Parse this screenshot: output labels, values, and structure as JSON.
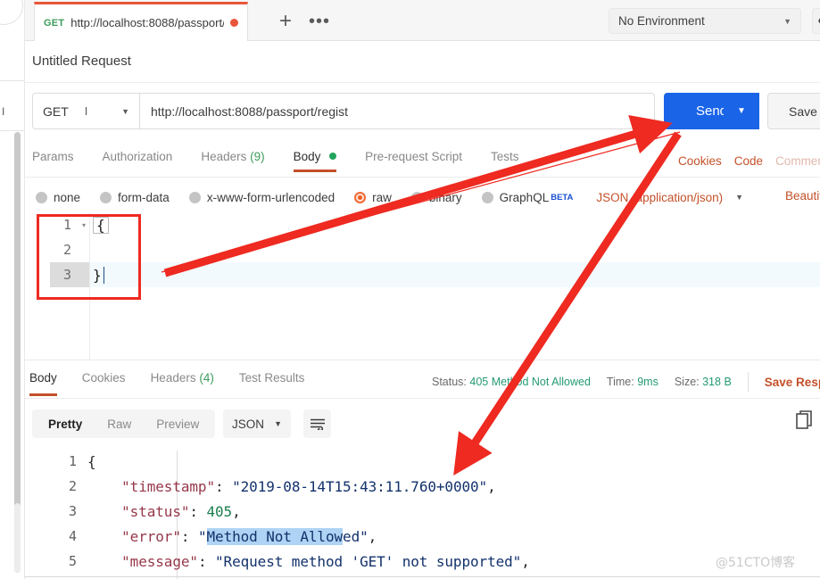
{
  "window": {
    "app": "Postman"
  },
  "tabbar": {
    "request_tab": {
      "method": "GET",
      "url": "http://localhost:8088/passport/...",
      "unsaved_dot": "unsaved-indicator"
    },
    "new_tab_label": "+",
    "more_label": "•••",
    "environment": {
      "selected": "No Environment",
      "caret": "▼"
    },
    "eye_icon": "eye-icon"
  },
  "request": {
    "title": "Untitled Request",
    "method": "GET",
    "method_caret": "▼",
    "url": "http://localhost:8088/passport/regist",
    "send_label": "Send",
    "send_caret": "▼",
    "save_label": "Save",
    "tabs": [
      {
        "label": "Params",
        "active": false
      },
      {
        "label": "Authorization",
        "active": false
      },
      {
        "label": "Headers",
        "count": "(9)",
        "active": false
      },
      {
        "label": "Body",
        "active": true,
        "dot": true
      },
      {
        "label": "Pre-request Script",
        "active": false
      },
      {
        "label": "Tests",
        "active": false
      }
    ],
    "actions": [
      {
        "label": "Cookies",
        "muted": false
      },
      {
        "label": "Code",
        "muted": false
      },
      {
        "label": "Comments",
        "muted": true
      }
    ],
    "body_types": [
      {
        "label": "none",
        "selected": false
      },
      {
        "label": "form-data",
        "selected": false
      },
      {
        "label": "x-www-form-urlencoded",
        "selected": false
      },
      {
        "label": "raw",
        "selected": true
      },
      {
        "label": "binary",
        "selected": false
      },
      {
        "label": "GraphQL",
        "selected": false,
        "badge": "BETA"
      }
    ],
    "content_type": "JSON (application/json)",
    "content_type_caret": "▼",
    "beautify_label": "Beautify",
    "body_editor": {
      "lines": [
        {
          "num": "1",
          "text": "{",
          "fold": "▾",
          "active": false
        },
        {
          "num": "2",
          "text": "",
          "fold": "",
          "active": false
        },
        {
          "num": "3",
          "text": "}",
          "fold": "",
          "active": true
        }
      ]
    }
  },
  "response": {
    "tabs": [
      {
        "label": "Body",
        "active": true
      },
      {
        "label": "Cookies",
        "active": false
      },
      {
        "label": "Headers",
        "count": "(4)",
        "active": false
      },
      {
        "label": "Test Results",
        "active": false
      }
    ],
    "status_label": "Status:",
    "status_value": "405 Method Not Allowed",
    "time_label": "Time:",
    "time_value": "9ms",
    "size_label": "Size:",
    "size_value": "318 B",
    "save_response_label": "Save Response",
    "views": [
      {
        "label": "Pretty",
        "active": true
      },
      {
        "label": "Raw",
        "active": false
      },
      {
        "label": "Preview",
        "active": false
      }
    ],
    "format": "JSON",
    "format_caret": "▼",
    "wrap_icon": "word-wrap-icon",
    "copy_icon": "copy-icon",
    "body_lines": [
      {
        "num": "1",
        "tokens": [
          {
            "t": "{",
            "c": "p"
          }
        ]
      },
      {
        "num": "2",
        "tokens": [
          {
            "t": "    ",
            "c": "p"
          },
          {
            "t": "\"timestamp\"",
            "c": "k"
          },
          {
            "t": ": ",
            "c": "p"
          },
          {
            "t": "\"2019-08-14T15:43:11.760+0000\"",
            "c": "s"
          },
          {
            "t": ",",
            "c": "p"
          }
        ]
      },
      {
        "num": "3",
        "tokens": [
          {
            "t": "    ",
            "c": "p"
          },
          {
            "t": "\"status\"",
            "c": "k"
          },
          {
            "t": ": ",
            "c": "p"
          },
          {
            "t": "405",
            "c": "n"
          },
          {
            "t": ",",
            "c": "p"
          }
        ]
      },
      {
        "num": "4",
        "tokens": [
          {
            "t": "    ",
            "c": "p"
          },
          {
            "t": "\"error\"",
            "c": "k"
          },
          {
            "t": ": ",
            "c": "p"
          },
          {
            "t": "\"",
            "c": "s"
          },
          {
            "t": "Method Not Allow",
            "c": "s sel"
          },
          {
            "t": "ed\"",
            "c": "s"
          },
          {
            "t": ",",
            "c": "p"
          }
        ]
      },
      {
        "num": "5",
        "tokens": [
          {
            "t": "    ",
            "c": "p"
          },
          {
            "t": "\"message\"",
            "c": "k"
          },
          {
            "t": ": ",
            "c": "p"
          },
          {
            "t": "\"Request method 'GET' not supported\"",
            "c": "s"
          },
          {
            "t": ",",
            "c": "p"
          }
        ]
      }
    ]
  },
  "watermark": "@51CTO博客",
  "annotations": {
    "arrow_1_name": "arrow-to-send-button",
    "arrow_2_name": "arrow-to-response-body",
    "rect_name": "highlight-request-body",
    "color": "#ee2a21"
  }
}
